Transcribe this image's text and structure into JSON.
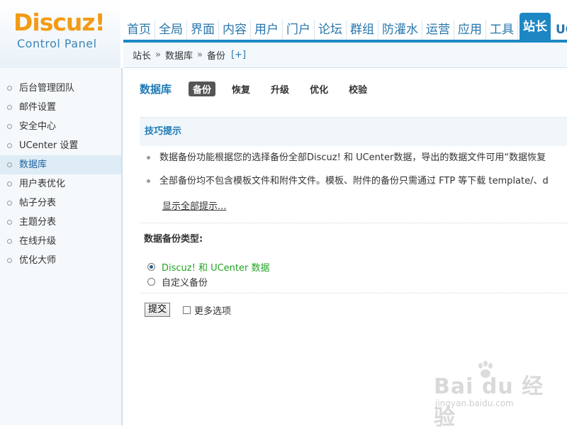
{
  "logo": {
    "brand": "Discuz!",
    "subtitle": "Control Panel"
  },
  "topnav": {
    "items": [
      "首页",
      "全局",
      "界面",
      "内容",
      "用户",
      "门户",
      "论坛",
      "群组",
      "防灌水",
      "运营",
      "应用",
      "工具",
      "站长",
      "UC"
    ],
    "active_index": 12
  },
  "breadcrumb": {
    "items": [
      "站长",
      "数据库",
      "备份"
    ],
    "separator": "»",
    "add": "[+]"
  },
  "sidebar": {
    "items": [
      "后台管理团队",
      "邮件设置",
      "安全中心",
      "UCenter 设置",
      "数据库",
      "用户表优化",
      "帖子分表",
      "主题分表",
      "在线升级",
      "优化大师"
    ],
    "active_index": 4
  },
  "main": {
    "title": "数据库",
    "tabs": [
      "备份",
      "恢复",
      "升级",
      "优化",
      "校验"
    ],
    "active_tab": 0,
    "tips": {
      "heading": "技巧提示",
      "lines": [
        "数据备份功能根据您的选择备份全部Discuz! 和 UCenter数据，导出的数据文件可用“数据恢复",
        "全部备份均不包含模板文件和附件文件。模板、附件的备份只需通过 FTP 等下载 template/、d"
      ],
      "show_all": "显示全部提示..."
    },
    "backup_type_label": "数据备份类型:",
    "options": [
      "Discuz! 和 UCenter 数据",
      "自定义备份"
    ],
    "selected_option": 0,
    "submit_label": "提交",
    "more_options_label": "更多选项"
  },
  "watermark": {
    "text": "Bai du 经验",
    "url": "jingyan.baidu.com"
  },
  "colors": {
    "accent": "#1d87c3",
    "logo": "#f39b16",
    "option_selected": "#22a322"
  }
}
